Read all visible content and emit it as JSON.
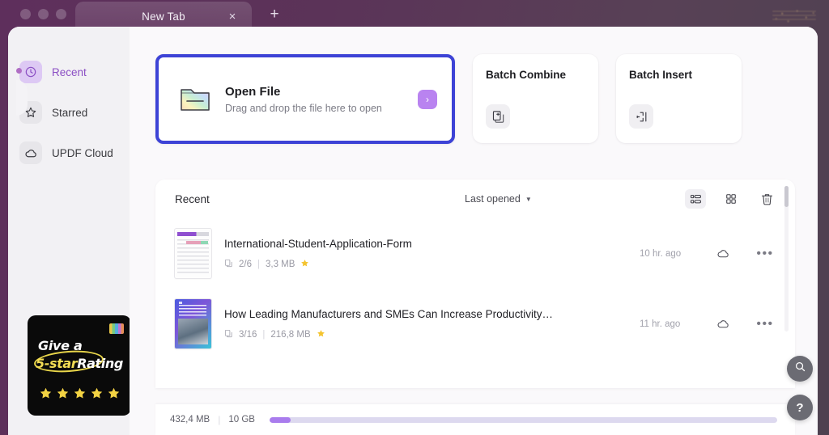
{
  "window": {
    "tab_title": "New Tab",
    "close_label": "×",
    "new_tab_label": "+"
  },
  "sidebar": {
    "items": [
      {
        "label": "Recent",
        "icon": "clock-icon",
        "active": true
      },
      {
        "label": "Starred",
        "icon": "star-icon",
        "active": false
      },
      {
        "label": "UPDF Cloud",
        "icon": "cloud-icon",
        "active": false
      }
    ],
    "promo": {
      "line1": "Give a",
      "line2_highlight": "5-star",
      "line2_rest": "Rating",
      "stars": 5
    }
  },
  "cards": {
    "open_file": {
      "title": "Open File",
      "subtitle": "Drag and drop the file here to open",
      "arrow": "›",
      "icon": "folder-icon",
      "accent": "#3d43d6"
    },
    "batch": [
      {
        "title": "Batch Combine",
        "icon": "combine-icon"
      },
      {
        "title": "Batch Insert",
        "icon": "insert-icon"
      }
    ]
  },
  "recent": {
    "heading": "Recent",
    "sort_value": "Last opened",
    "tools": [
      {
        "name": "list-view-icon",
        "active": true
      },
      {
        "name": "grid-view-icon",
        "active": false
      },
      {
        "name": "trash-icon",
        "active": false
      }
    ],
    "files": [
      {
        "name": "International-Student-Application-Form",
        "pages": "2/6",
        "size": "3,3 MB",
        "starred": true,
        "time": "10 hr. ago",
        "cloud": "cloud-icon",
        "more": "•••"
      },
      {
        "name": "How Leading Manufacturers and SMEs Can Increase Productivity…",
        "pages": "3/16",
        "size": "216,8 MB",
        "starred": true,
        "time": "11 hr. ago",
        "cloud": "cloud-icon",
        "more": "•••"
      }
    ]
  },
  "storage": {
    "used": "432,4 MB",
    "divider": "|",
    "total": "10 GB",
    "percent": 4.2,
    "fill_color": "#a97ced"
  },
  "fabs": [
    {
      "name": "search-fab",
      "icon": "search-icon"
    },
    {
      "name": "help-fab",
      "icon": "question-icon",
      "label": "?"
    }
  ]
}
